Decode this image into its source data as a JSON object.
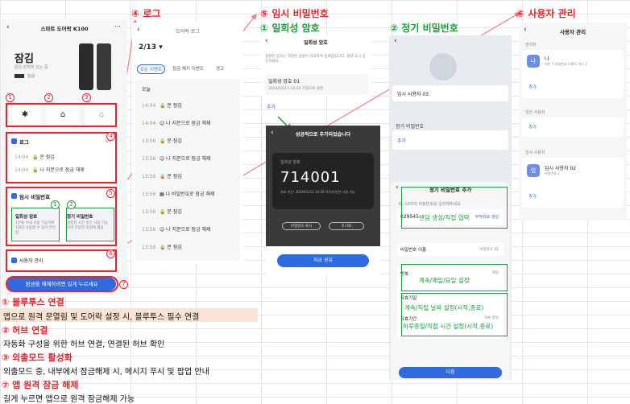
{
  "headers": {
    "log": "④ 로그",
    "temp_pw": "⑤ 임시 비밀번호",
    "onetime": "① 일회성 암호",
    "regular": "② 정기 비밀번호",
    "users": "⑥ 사용자 관리"
  },
  "home": {
    "title": "스마트 도어락 K100",
    "status": "잠김",
    "status_sub": "문은 닫혀져 있는 중",
    "battery_label": "높음",
    "log_label": "로그",
    "log_more": "모든",
    "log_rows": [
      {
        "time": "14:04",
        "text": "문 잠김"
      },
      {
        "time": "14:04",
        "text": "나 지문으로 잠금 해제"
      }
    ],
    "temp_pw_label": "임시 비밀번호",
    "onetime_card_title": "일회성 암호",
    "onetime_card_desc": "1분류 이내 사용 가능하며 1회만 사용할 수 있어 안전함",
    "regular_card_title": "정기 비밀번호",
    "regular_card_desc": "설정한 시간 동안 사용 가능하며 다양한 일정에 활용",
    "user_mgmt_label": "사용자 관리",
    "unlock_button": "잠금을 해제하려면 길게 누르세요"
  },
  "logs_screen": {
    "title": "도어락 로그",
    "date": "2/13",
    "filters": [
      "모든 이벤트",
      "잠금 해지 이벤트",
      "경고"
    ],
    "today": "오늘",
    "rows": [
      {
        "time": "14:04",
        "text": "문 잠김"
      },
      {
        "time": "14:04",
        "text": "나 지문으로 잠금 해제"
      },
      {
        "time": "13:56",
        "text": "문 잠김"
      },
      {
        "time": "13:56",
        "text": "나 지문으로 잠금 해제"
      },
      {
        "time": "13:56",
        "text": "문 잠김"
      },
      {
        "time": "13:56",
        "text": "나 비밀번호로 잠금 해제"
      },
      {
        "time": "13:56",
        "text": "문 잠김"
      },
      {
        "time": "13:56",
        "text": "나 지문으로 잠금 해제"
      },
      {
        "time": "13:56",
        "text": "문 잠김"
      }
    ]
  },
  "onetime_screen": {
    "title": "일회성 암호",
    "desc": "생성된 암호는 지정된 설정이 유효하며 일회용입니다. 생성 즉시 공유하세요.",
    "entry_title": "일회성 암호 01",
    "entry_time": "2024/02/13 14:20 지정으로 설정",
    "add": "추가",
    "popup_title": "성공적으로 추가되었습니다",
    "popup_label": "일회성 암호",
    "code": "714001",
    "popup_note": "유효 기간: 2024/02/13 14:20 이후에 한번 사용 가능",
    "copy_button": "비밀번호 복사",
    "share_button": "초기화",
    "share_now": "지금 공유"
  },
  "regular_screen": {
    "user_name": "임시 사용자 03",
    "section": "정기 비밀번호",
    "add": "추가",
    "popup_title": "정기 비밀번호 추가",
    "hint": "6~10자의 비밀번호를 입력해주세요",
    "pw_value": "029545",
    "random_btn": "무작위로 생성",
    "random_note": "랜덤 생성/직접 입력",
    "name_label": "비밀번호 이름",
    "name_value": "비밀번호 01",
    "repeat_label": "반복",
    "repeat_value": "매일",
    "repeat_note": "계속/매일/요일 설정",
    "valid_label": "유효기일",
    "valid_note": "계속/직접 날짜 설정(시작,종료)",
    "time_label": "유효기간",
    "time_value": "하루 종일",
    "time_note": "하루종일/직접 시간 설정(시작,종료)",
    "next": "다음"
  },
  "users_screen": {
    "title": "사용자 관리",
    "admin": "관리자",
    "admin_name": "나",
    "admin_sub": "지문 7 비밀번호 2 NFC 카드 2",
    "add": "추가",
    "normal": "일반 사용자",
    "temp": "임시 사용자",
    "temp_name": "임시 사용자 02",
    "temp_sub": "비밀번호 1",
    "avatar_admin": "나",
    "avatar_temp": "임"
  },
  "notes": [
    {
      "title": "① 블루투스 연결",
      "body": "앱으로 원격 문열림 및 도어락 설정 시, 블루투스 필수 연결"
    },
    {
      "title": "② 허브 연결",
      "body": "자동화 구성을 위한 허브 연결, 연결된 허브 확인"
    },
    {
      "title": "③ 외출모드 활성화",
      "body": "외출모드 중, 내부에서 잠금해제 시, 메시지 푸시 및 팝업 안내"
    },
    {
      "title": "⑦ 앱 원격 잠금 해제",
      "body": "길게 누르면 앱으로 원격 잠금해제 가능"
    }
  ],
  "colors": {
    "red": "#e8232a",
    "green": "#1f9d3a",
    "blue": "#2f6ae0",
    "highlight": "#fbe4d6"
  }
}
